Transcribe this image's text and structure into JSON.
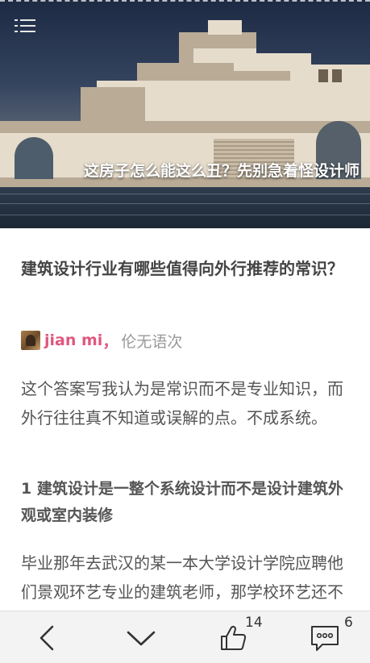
{
  "hero": {
    "title": "这房子怎么能这么丑？先别急着怪设计师",
    "menu_icon": "hamburger-menu-icon"
  },
  "article": {
    "question_title": "建筑设计行业有哪些值得向外行推荐的常识？",
    "author": {
      "name": "jian mi",
      "separator": "，",
      "bio": "伦无语次"
    },
    "paragraphs": [
      "这个答案写我认为是常识而不是专业知识，而外行往往真不知道或误解的点。不成系统。",
      "毕业那年去武汉的某一本大学设计学院应聘他们景观环艺专业的建筑老师，那学校环艺还不错了以说是最大的专业了，为了加强学"
    ],
    "section_heading": "1 建筑设计是一整个系统设计而不是设计建筑外观或室内装修"
  },
  "bottom_bar": {
    "back_icon": "chevron-left-icon",
    "next_icon": "chevron-down-icon",
    "like_icon": "thumbs-up-icon",
    "like_count": "14",
    "comment_icon": "comment-bubble-icon",
    "comment_count": "6"
  },
  "colors": {
    "author_name": "#e0577f",
    "body_text": "#555555",
    "bar_background": "#f3f3f3"
  }
}
